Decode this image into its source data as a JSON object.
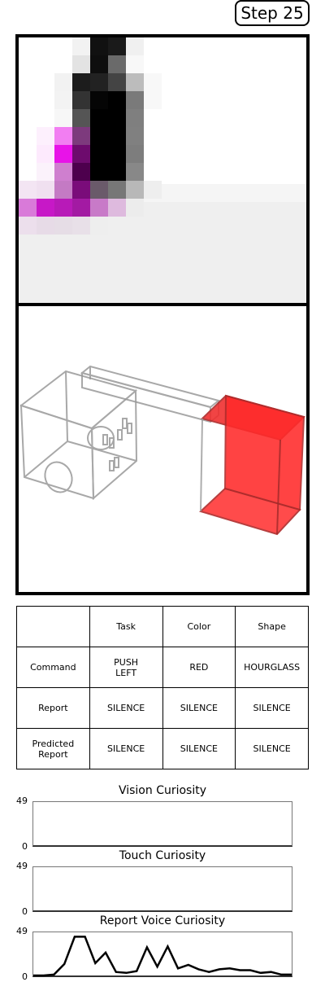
{
  "step": {
    "label": "Step 25"
  },
  "table": {
    "headers": [
      "",
      "Task",
      "Color",
      "Shape"
    ],
    "rows": [
      {
        "label": "Command",
        "task": "PUSH\nLEFT",
        "color": "RED",
        "shape": "HOURGLASS"
      },
      {
        "label": "Report",
        "task": "SILENCE",
        "color": "SILENCE",
        "shape": "SILENCE"
      },
      {
        "label": "Predicted\nReport",
        "task": "SILENCE",
        "color": "SILENCE",
        "shape": "SILENCE"
      }
    ]
  },
  "charts": [
    {
      "title": "Vision Curiosity",
      "ymax": "49",
      "ymin": "0"
    },
    {
      "title": "Touch Curiosity",
      "ymax": "49",
      "ymin": "0"
    },
    {
      "title": "Report Voice Curiosity",
      "ymax": "49",
      "ymin": "0"
    }
  ],
  "chart_data": [
    {
      "type": "line",
      "title": "Vision Curiosity",
      "ylim": [
        0,
        49
      ],
      "series": [
        {
          "values": []
        }
      ]
    },
    {
      "type": "line",
      "title": "Touch Curiosity",
      "ylim": [
        0,
        49
      ],
      "series": [
        {
          "values": []
        }
      ]
    },
    {
      "type": "line",
      "title": "Report Voice Curiosity",
      "ylim": [
        0,
        49
      ],
      "x": [
        0,
        1,
        2,
        3,
        4,
        5,
        6,
        7,
        8,
        9,
        10,
        11,
        12,
        13,
        14,
        15,
        16,
        17,
        18,
        19,
        20,
        21,
        22,
        23,
        24,
        25
      ],
      "series": [
        {
          "values": [
            0,
            0,
            1,
            13,
            44,
            44,
            14,
            26,
            4,
            3,
            5,
            32,
            10,
            33,
            8,
            12,
            7,
            4,
            7,
            8,
            6,
            6,
            3,
            4,
            1,
            1
          ]
        }
      ]
    }
  ],
  "colors": {
    "object": "#ff2a2a",
    "vision_magenta": "#e020e0"
  }
}
